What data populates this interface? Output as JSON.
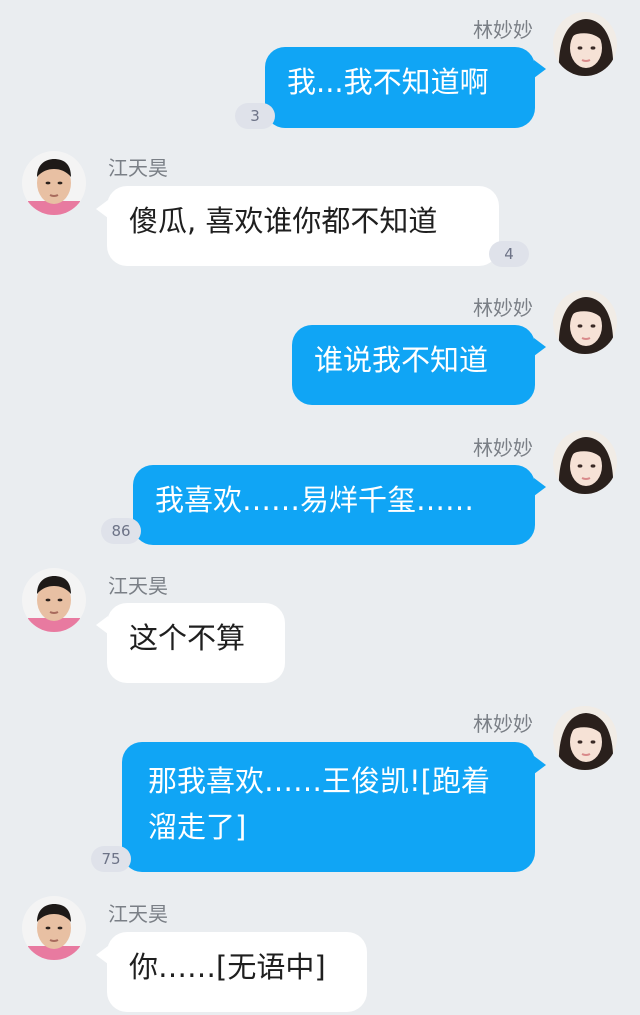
{
  "participants": {
    "female": {
      "name": "林妙妙",
      "avatar_icon": "girl-avatar-icon"
    },
    "male": {
      "name": "江天昊",
      "avatar_icon": "boy-avatar-icon"
    }
  },
  "messages": [
    {
      "sender": "林妙妙",
      "text": "我...我不知道啊",
      "count": "3"
    },
    {
      "sender": "江天昊",
      "text": "傻瓜, 喜欢谁你都不知道",
      "count": "4"
    },
    {
      "sender": "林妙妙",
      "text": "谁说我不知道",
      "count": ""
    },
    {
      "sender": "林妙妙",
      "text": "我喜欢……易烊千玺……",
      "count": "86"
    },
    {
      "sender": "江天昊",
      "text": "这个不算",
      "count": ""
    },
    {
      "sender": "林妙妙",
      "text": "那我喜欢……王俊凯![跑着溜走了]",
      "count": "75"
    },
    {
      "sender": "江天昊",
      "text": "你……[无语中]",
      "count": ""
    }
  ],
  "colors": {
    "background": "#eaedf0",
    "outgoing_bubble": "#10a5f5",
    "incoming_bubble": "#ffffff",
    "badge": "#dfe2ea"
  }
}
